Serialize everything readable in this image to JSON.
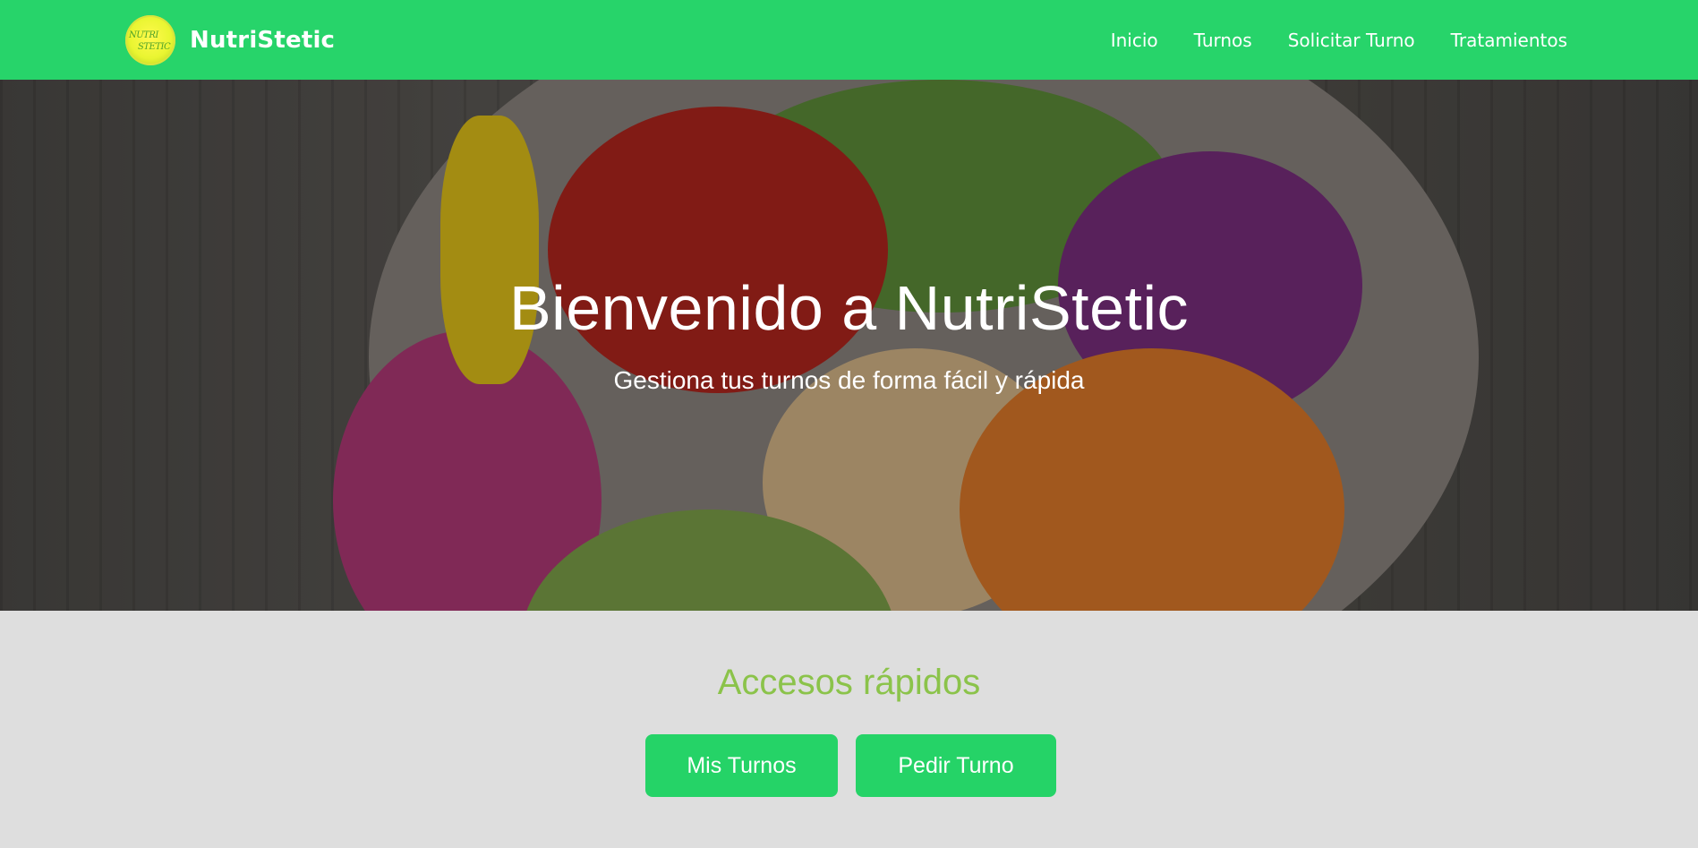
{
  "navbar": {
    "logo_text_line1": "NUTRI",
    "logo_text_line2": "STETIC",
    "brand": "NutriStetic",
    "links": [
      "Inicio",
      "Turnos",
      "Solicitar Turno",
      "Tratamientos"
    ]
  },
  "hero": {
    "title": "Bienvenido a NutriStetic",
    "subtitle": "Gestiona tus turnos de forma fácil y rápida"
  },
  "quick_access": {
    "title": "Accesos rápidos",
    "buttons": [
      "Mis Turnos",
      "Pedir Turno"
    ]
  },
  "colors": {
    "navbar": "#27d46a",
    "button": "#25d367",
    "section_title": "#8bc34a",
    "section_bg": "#dedede"
  }
}
